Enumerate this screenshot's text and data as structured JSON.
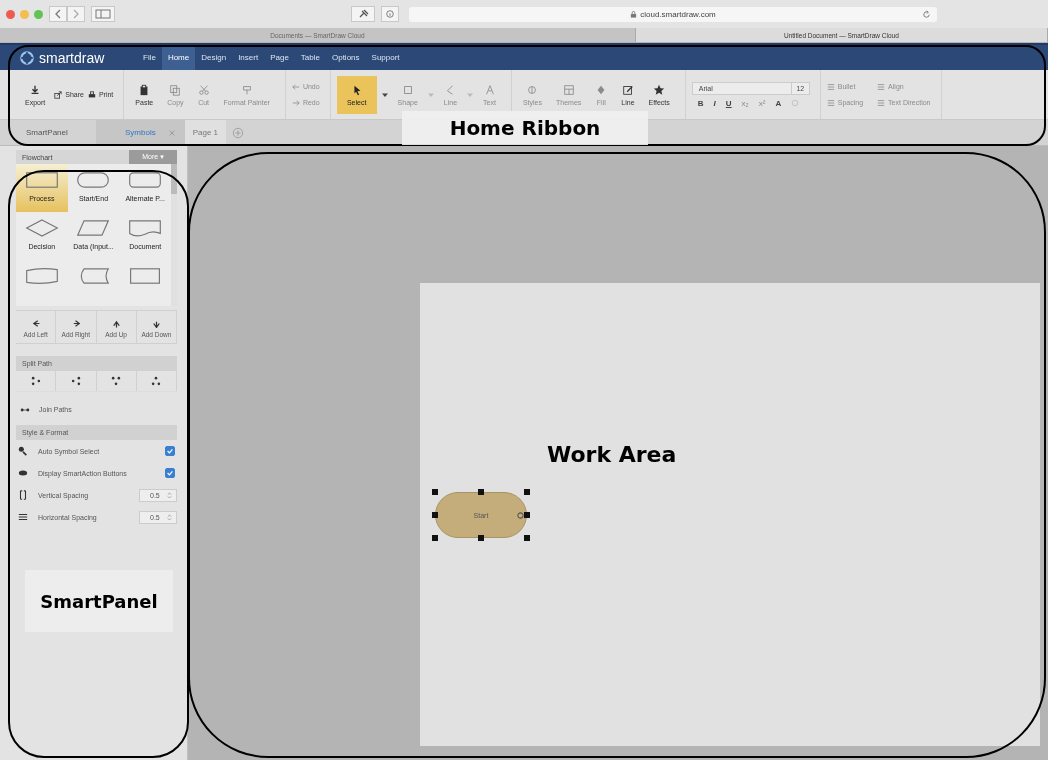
{
  "browser": {
    "url": "cloud.smartdraw.com",
    "tabs": [
      {
        "title": "Documents — SmartDraw Cloud",
        "selected": false
      },
      {
        "title": "Untitled Document — SmartDraw Cloud",
        "selected": true
      }
    ]
  },
  "app": {
    "logo": "smartdraw",
    "menu": [
      {
        "label": "File",
        "selected": false
      },
      {
        "label": "Home",
        "selected": true
      },
      {
        "label": "Design",
        "selected": false
      },
      {
        "label": "Insert",
        "selected": false
      },
      {
        "label": "Page",
        "selected": false
      },
      {
        "label": "Table",
        "selected": false
      },
      {
        "label": "Options",
        "selected": false
      },
      {
        "label": "Support",
        "selected": false
      }
    ]
  },
  "ribbon": {
    "groups": [
      {
        "items": [
          {
            "label": "Export",
            "kind": "large",
            "disabled": false
          },
          {
            "label": "Share",
            "kind": "small",
            "disabled": false
          },
          {
            "label": "Print",
            "kind": "small",
            "disabled": false
          }
        ]
      },
      {
        "items": [
          {
            "label": "Paste",
            "kind": "large",
            "disabled": false
          },
          {
            "label": "Copy",
            "kind": "large",
            "disabled": true
          },
          {
            "label": "Cut",
            "kind": "large",
            "disabled": true
          },
          {
            "label": "Format Painter",
            "kind": "large",
            "disabled": true
          }
        ]
      },
      {
        "items": [
          {
            "label": "Undo",
            "kind": "small",
            "disabled": true
          },
          {
            "label": "Redo",
            "kind": "small",
            "disabled": true
          }
        ]
      },
      {
        "items": [
          {
            "label": "Select",
            "kind": "large",
            "disabled": false,
            "selected": true,
            "dropdown": true
          },
          {
            "label": "Shape",
            "kind": "large",
            "disabled": true,
            "selected": false,
            "dropdown": true
          },
          {
            "label": "Line",
            "kind": "large",
            "disabled": true,
            "selected": false,
            "dropdown": true
          },
          {
            "label": "Text",
            "kind": "large",
            "disabled": true,
            "selected": false,
            "dropdown": false
          }
        ]
      },
      {
        "items": [
          {
            "label": "Styles",
            "kind": "large",
            "disabled": true
          },
          {
            "label": "Themes",
            "kind": "large",
            "disabled": true
          },
          {
            "label": "Fill",
            "kind": "large",
            "disabled": true
          },
          {
            "label": "Line",
            "kind": "large",
            "disabled": false
          },
          {
            "label": "Effects",
            "kind": "large",
            "disabled": false
          }
        ]
      }
    ],
    "font": {
      "name": "Arial",
      "size": "12",
      "format_buttons": [
        {
          "label": "B",
          "disabled": false
        },
        {
          "label": "I",
          "disabled": false
        },
        {
          "label": "U",
          "disabled": false
        },
        {
          "label": "x₂",
          "disabled": true
        },
        {
          "label": "x²",
          "disabled": true
        },
        {
          "label": "A",
          "disabled": false
        }
      ]
    },
    "paragraph": [
      {
        "label": "Bullet",
        "disabled": true
      },
      {
        "label": "Align",
        "disabled": true
      },
      {
        "label": "Spacing",
        "disabled": true
      },
      {
        "label": "Text Direction",
        "disabled": true
      }
    ]
  },
  "doc_tabs": [
    {
      "label": "SmartPanel",
      "kind": "panel"
    },
    {
      "label": "Symbols",
      "kind": "tab",
      "selected": true,
      "closable": true
    },
    {
      "label": "Page 1",
      "kind": "tab",
      "selected": false,
      "closable": false
    }
  ],
  "smart_panel": {
    "library": "Flowchart",
    "more": "More ▾",
    "shapes": [
      {
        "label": "Process",
        "selected": true
      },
      {
        "label": "Start/End",
        "selected": false
      },
      {
        "label": "Alternate P...",
        "selected": false
      },
      {
        "label": "Decision",
        "selected": false
      },
      {
        "label": "Data (Input...",
        "selected": false
      },
      {
        "label": "Document",
        "selected": false
      },
      {
        "selected": false
      },
      {
        "selected": false
      },
      {
        "selected": false
      }
    ],
    "add_buttons": [
      "Add Left",
      "Add Right",
      "Add Up",
      "Add Down"
    ],
    "split_path": "Split Path",
    "join_paths": "Join Paths",
    "style_title": "Style & Format",
    "options": [
      {
        "label": "Auto Symbol Select",
        "kind": "checkbox",
        "checked": true
      },
      {
        "label": "Display SmartAction Buttons",
        "kind": "checkbox",
        "checked": true
      },
      {
        "label": "Vertical Spacing",
        "kind": "spinner",
        "value": "0.5"
      },
      {
        "label": "Horizontal Spacing",
        "kind": "spinner",
        "value": "0.5"
      }
    ]
  },
  "canvas": {
    "shape": {
      "label": "Start",
      "selected": true
    }
  },
  "annotations": [
    {
      "text": "Home Ribbon"
    },
    {
      "text": "SmartPanel"
    },
    {
      "text": "Work Area"
    }
  ]
}
